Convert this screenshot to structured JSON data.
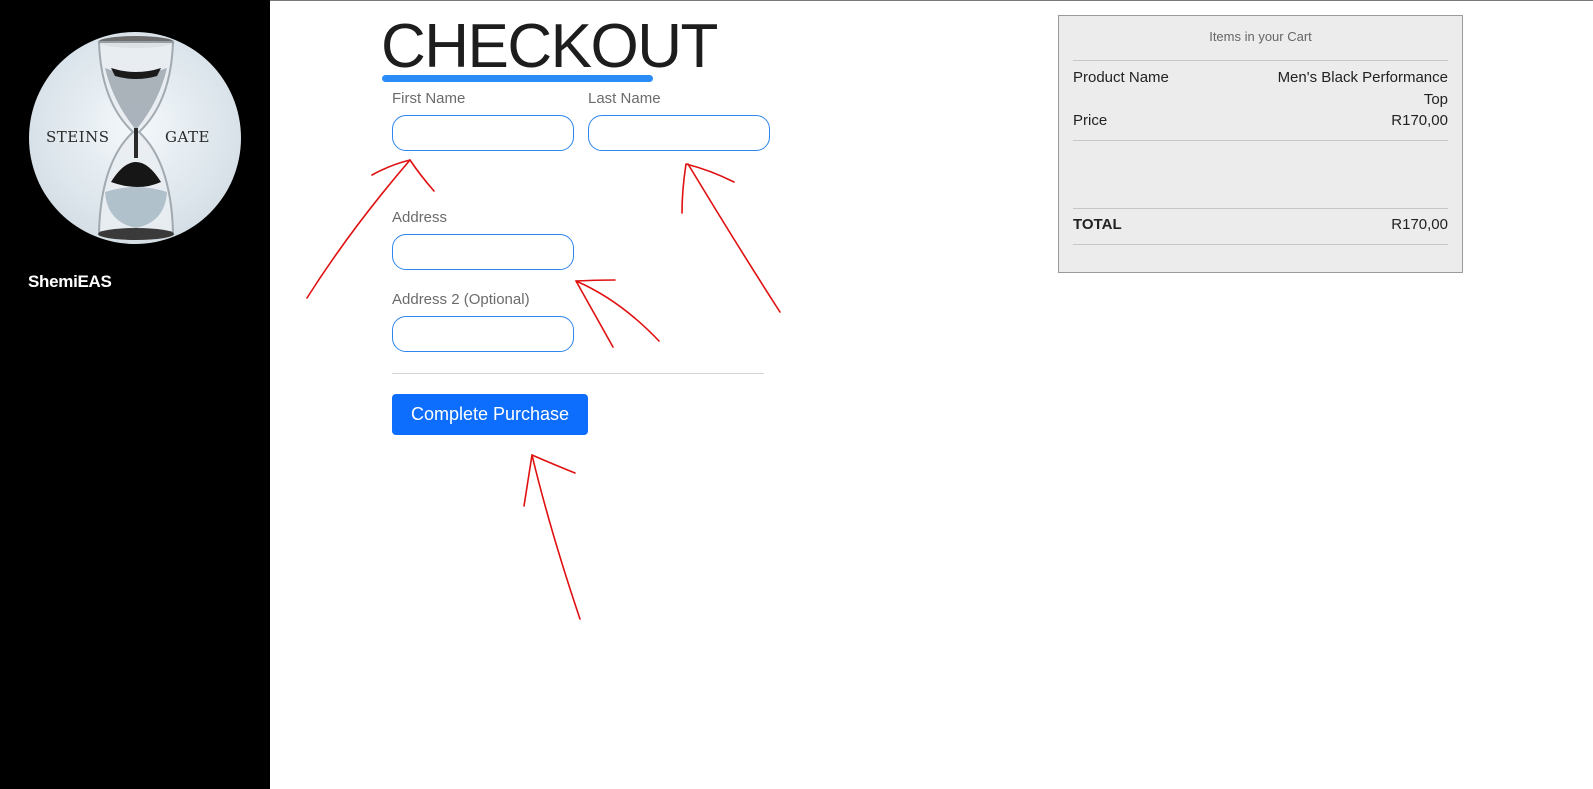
{
  "sidebar": {
    "logo": {
      "left_text": "STEINS",
      "right_text": "GATE"
    },
    "username": "ShemiEAS"
  },
  "main": {
    "heading": "CHECKOUT",
    "fields": {
      "first_name": {
        "label": "First Name",
        "value": ""
      },
      "last_name": {
        "label": "Last Name",
        "value": ""
      },
      "address": {
        "label": "Address",
        "value": ""
      },
      "address2": {
        "label": "Address 2 (Optional)",
        "value": ""
      }
    },
    "button": "Complete Purchase"
  },
  "cart": {
    "title": "Items in your Cart",
    "product_name_label": "Product Name",
    "product_name_line1": "Men's Black Performance",
    "product_name_line2": "Top",
    "price_label": "Price",
    "price_value": "R170,00",
    "total_label": "TOTAL",
    "total_value": "R170,00"
  },
  "colors": {
    "accent": "#0d6efd",
    "underline": "#2a8cf7",
    "annotation": "#e01010",
    "sidebar": "#000000",
    "cart_bg": "#ececec"
  }
}
